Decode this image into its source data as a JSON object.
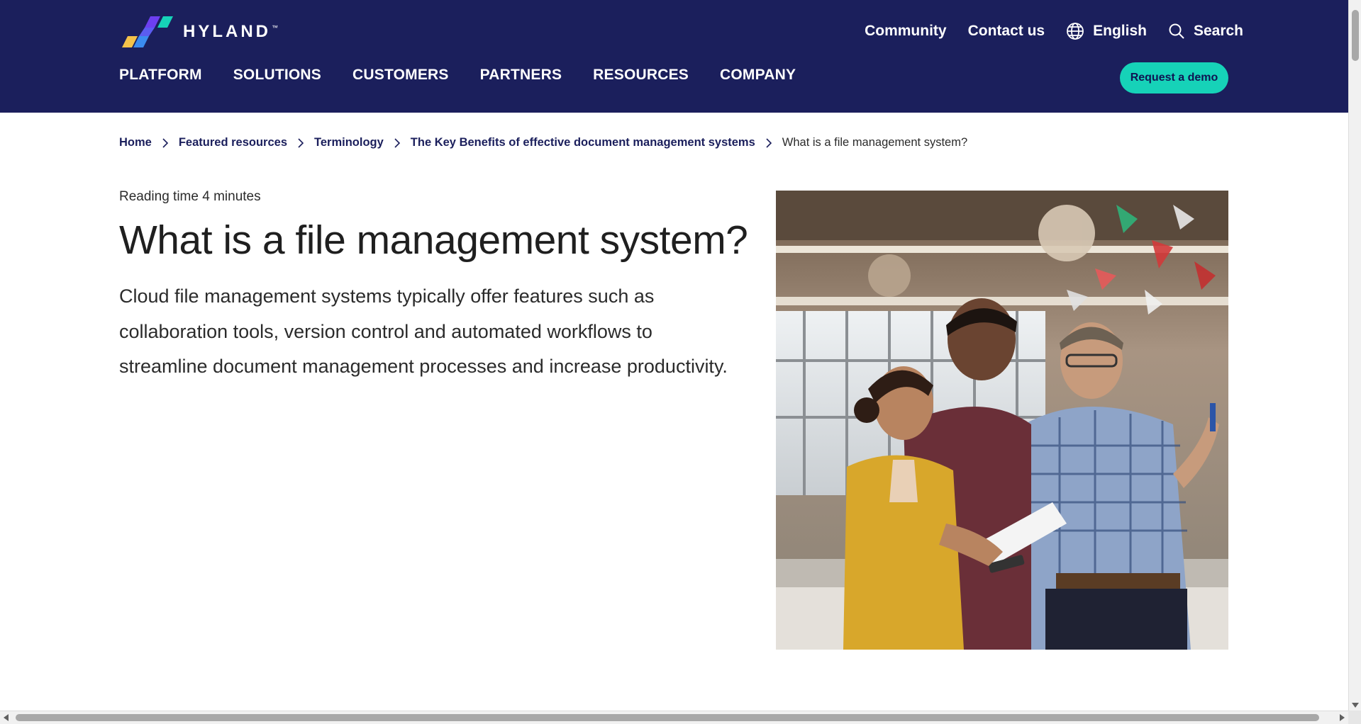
{
  "brand": {
    "name": "HYLAND",
    "trademark": "™",
    "colors": {
      "navy": "#1b1f5c",
      "teal": "#16d2b8",
      "purple": "#6d3ff0",
      "blue": "#3b8cf0",
      "yellow": "#f4c24a"
    }
  },
  "utility_nav": {
    "community": "Community",
    "contact": "Contact us",
    "language": "English",
    "search": "Search"
  },
  "main_nav": {
    "items": [
      "PLATFORM",
      "SOLUTIONS",
      "CUSTOMERS",
      "PARTNERS",
      "RESOURCES",
      "COMPANY"
    ]
  },
  "cta": {
    "demo_label": "Request a demo"
  },
  "breadcrumb": {
    "items": [
      "Home",
      "Featured resources",
      "Terminology",
      "The Key Benefits of effective document management systems"
    ],
    "current": "What is a file management system?"
  },
  "article": {
    "reading_time": "Reading time 4 minutes",
    "title": "What is a file management system?",
    "lead": "Cloud file management systems typically offer features such as collaboration tools, version control and automated workflows to streamline document management processes and increase productivity."
  },
  "icons": {
    "globe": "globe-icon",
    "search": "search-icon",
    "chevron": "chevron-right-icon"
  }
}
